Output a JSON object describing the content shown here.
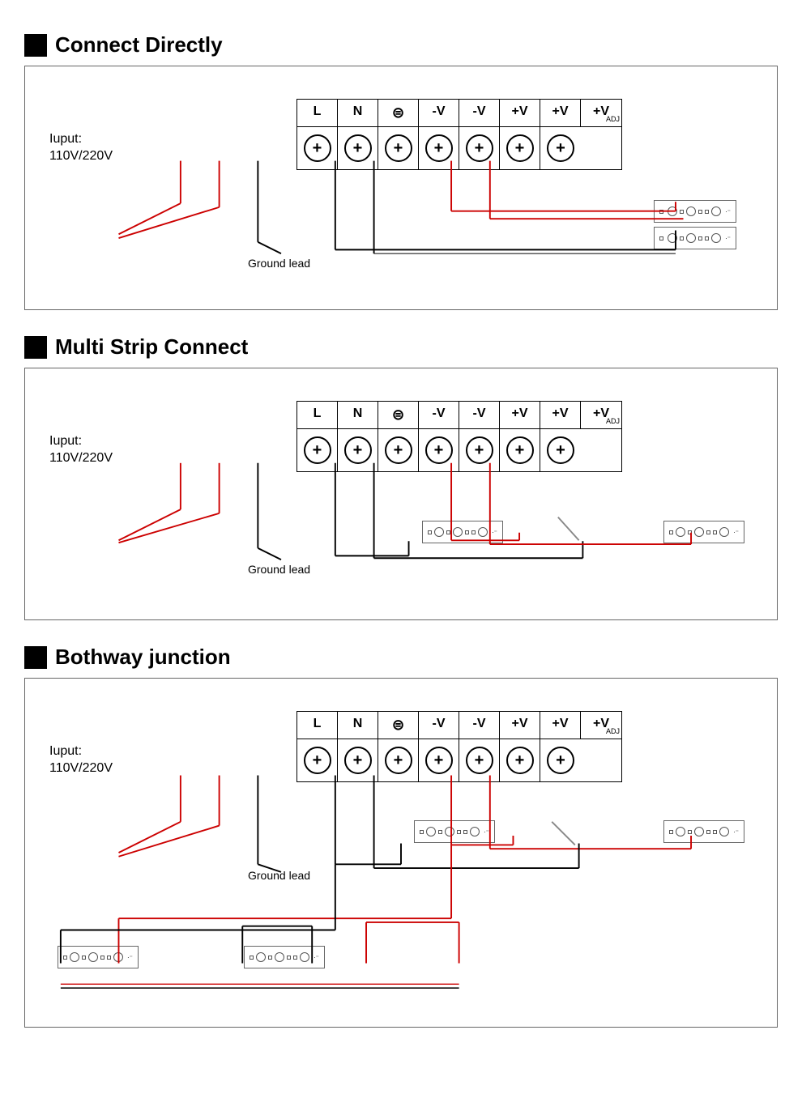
{
  "sections": [
    {
      "id": "connect-directly",
      "title": "Connect Directly",
      "type": "direct"
    },
    {
      "id": "multi-strip",
      "title": "Multi Strip Connect",
      "type": "multi"
    },
    {
      "id": "bothway",
      "title": "Bothway junction",
      "type": "bothway"
    }
  ],
  "terminal": {
    "labels": [
      "L",
      "N",
      "⊜",
      "-V",
      "-V",
      "+V",
      "+V",
      "+V"
    ],
    "adj_index": 7
  },
  "input_label": "Iuput:\n110V/220V",
  "ground_lead": "Ground lead"
}
